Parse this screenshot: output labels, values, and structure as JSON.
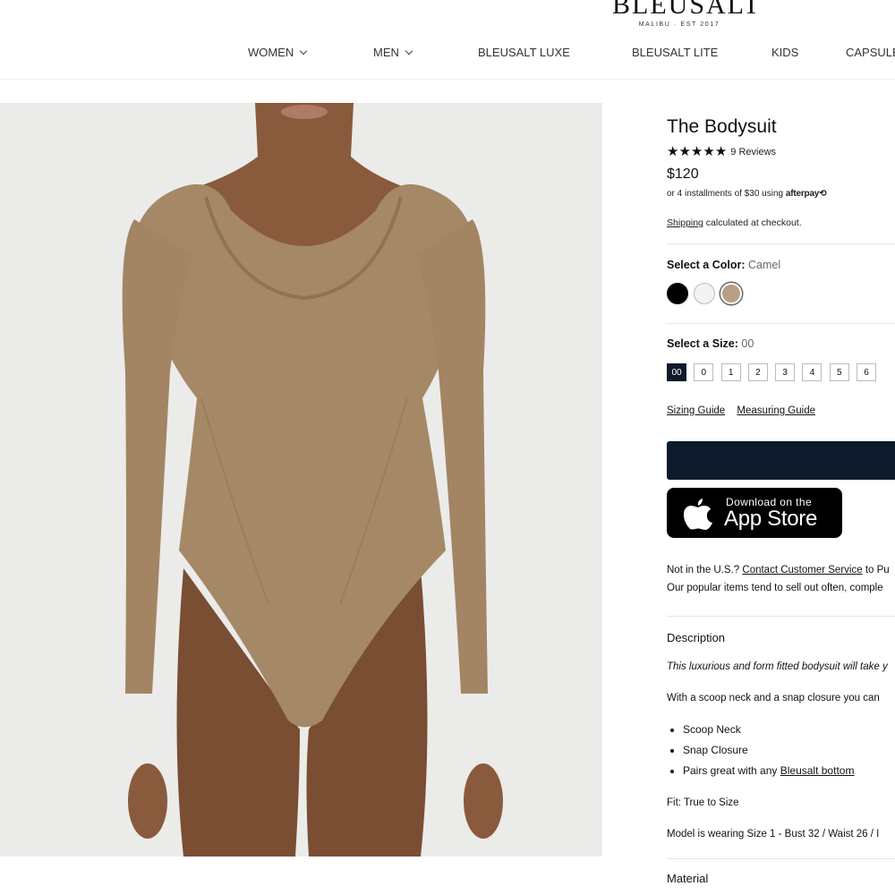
{
  "header": {
    "brand": "BLEUSALT",
    "brand_sub": "MALIBU · EST 2017",
    "nav": {
      "women": "WOMEN",
      "men": "MEN",
      "luxe": "BLEUSALT LUXE",
      "lite": "BLEUSALT LITE",
      "kids": "KIDS",
      "capsule": "CAPSULE"
    }
  },
  "product": {
    "title": "The Bodysuit",
    "rating": 5,
    "reviews": "9 Reviews",
    "price": "$120",
    "installments_text": "or 4 installments of $30 using",
    "afterpay": "afterpay⟲",
    "shipping_link": "Shipping",
    "shipping_text": "calculated at checkout.",
    "color_label": "Select a Color:",
    "color_value": "Camel",
    "colors": [
      {
        "name": "Black",
        "hex": "#000000"
      },
      {
        "name": "White",
        "hex": "#f3f3f3"
      },
      {
        "name": "Camel",
        "hex": "#b89f84"
      }
    ],
    "size_label": "Select a Size:",
    "size_value": "00",
    "sizes": [
      "00",
      "0",
      "1",
      "2",
      "3",
      "4",
      "5",
      "6"
    ],
    "sizing_guide": "Sizing Guide",
    "measuring_guide": "Measuring Guide",
    "appstore_small": "Download on the",
    "appstore_big": "App Store",
    "not_us_prefix": "Not in the U.S.?",
    "contact_link": "Contact Customer Service",
    "not_us_suffix": "to Pu",
    "popular_text": "Our popular items tend to sell out often, comple",
    "description_head": "Description",
    "desc_italic": "This luxurious and form fitted bodysuit will take y",
    "desc_text": "With a scoop neck and a snap closure you can",
    "bullets": {
      "b1": "Scoop Neck",
      "b2": "Snap Closure",
      "b3_prefix": "Pairs great with any",
      "b3_link": "Bleusalt bottom"
    },
    "fit": "Fit: True to Size",
    "model": "Model is wearing Size 1 - Bust 32 / Waist 26 / I",
    "material_head": "Material"
  },
  "colors": {
    "navy_button": "#0d1a2b",
    "camel": "#b89f84"
  }
}
